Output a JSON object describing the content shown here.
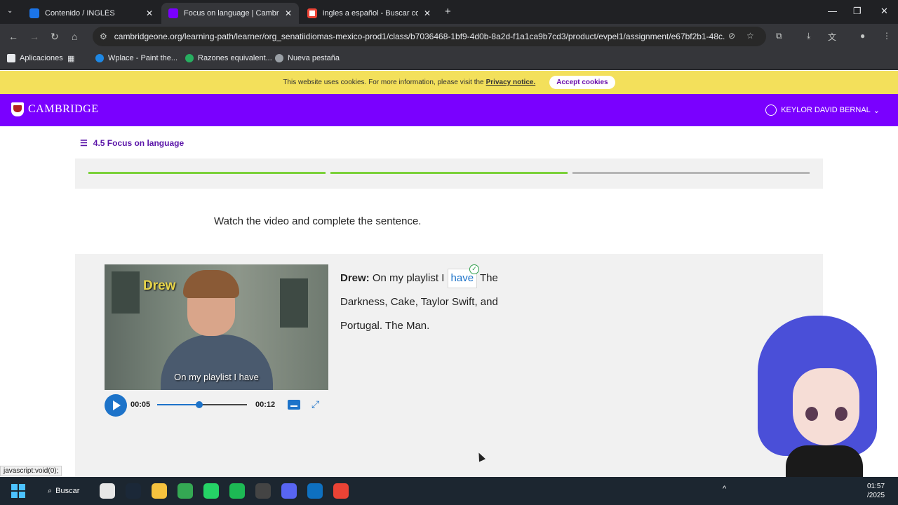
{
  "browser": {
    "tabs": [
      {
        "label": "Contenido / INGLÉS",
        "active": false,
        "favicon_color": "#1b74e8"
      },
      {
        "label": "Focus on language | Cambridge",
        "active": true,
        "favicon_color": "#7a00ff"
      },
      {
        "label": "ingles a español - Buscar con Google",
        "active": false,
        "favicon_color": "#ea4335"
      }
    ],
    "new_tab_symbol": "+",
    "url": "cambridgeone.org/learning-path/learner/org_senatiidiomas-mexico-prod1/class/b7036468-1bf9-4d0b-8a2d-f1a1ca9b7cd3/product/evpel1/assignment/e67bf2b1-48c...",
    "bookmarks": [
      {
        "label": "Aplicaciones",
        "color": "#e8eaed"
      },
      {
        "label": "Wplace - Paint the...",
        "color": "#1e88e5"
      },
      {
        "label": "Razones equivalent...",
        "color": "#27ae60"
      },
      {
        "label": "Nueva pestaña",
        "color": "#9aa0a6"
      }
    ]
  },
  "cookie_banner": {
    "text": "This website uses cookies. For more information, please visit the",
    "link": "Privacy notice.",
    "button": "Accept cookies"
  },
  "header": {
    "logo": "CAMBRIDGE",
    "user": "KEYLOR DAVID BERNAL"
  },
  "lesson": {
    "breadcrumb": "4.5 Focus on language",
    "progress_segments": [
      "complete",
      "complete",
      "incomplete"
    ],
    "progress_colors": {
      "complete": "#7bd13a",
      "incomplete": "#b5b5b5"
    },
    "instruction": "Watch the video and complete the sentence."
  },
  "video": {
    "name_overlay": "Drew",
    "caption": "On my playlist I have",
    "current_time": "00:05",
    "total_time": "00:12",
    "progress_fraction": 0.47
  },
  "sentence": {
    "speaker": "Drew:",
    "before": " On my playlist I ",
    "answer": "have",
    "after": " The Darkness, Cake, Taylor Swift, and Portugal. The Man."
  },
  "status_bar": "javascript:void(0);",
  "taskbar": {
    "search": "Buscar",
    "clock_time": "01:57",
    "clock_date": "/2025",
    "apps": [
      {
        "name": "store-icon",
        "color": "#e6e6e6"
      },
      {
        "name": "steam-icon",
        "color": "#1b2838"
      },
      {
        "name": "file-explorer-icon",
        "color": "#f6c23e"
      },
      {
        "name": "chrome-icon",
        "color": "#34a853"
      },
      {
        "name": "whatsapp-icon",
        "color": "#25d366"
      },
      {
        "name": "spotify-icon",
        "color": "#1db954"
      },
      {
        "name": "app-icon",
        "color": "#444"
      },
      {
        "name": "discord-icon",
        "color": "#5865f2"
      },
      {
        "name": "vscode-icon",
        "color": "#0e70c0"
      },
      {
        "name": "chrome-alt-icon",
        "color": "#ea4335"
      }
    ]
  }
}
